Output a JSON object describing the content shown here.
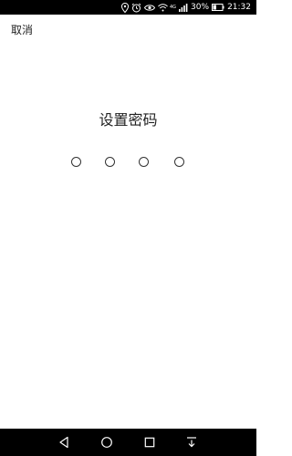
{
  "status_bar": {
    "network_label": "4G",
    "battery_text": "30%",
    "time": "21:32",
    "icons": [
      "location-icon",
      "alarm-icon",
      "eye-icon",
      "wifi-icon",
      "signal-icon",
      "battery-icon"
    ]
  },
  "header": {
    "cancel_label": "取消"
  },
  "main": {
    "title": "设置密码",
    "pin_length": 4
  },
  "nav_bar": {
    "buttons": [
      "back-icon",
      "home-icon",
      "recents-icon",
      "notification-pulldown-icon"
    ]
  },
  "colors": {
    "status_bar_bg": "#000000",
    "nav_bar_bg": "#000000",
    "background": "#ffffff",
    "text": "#222222"
  }
}
